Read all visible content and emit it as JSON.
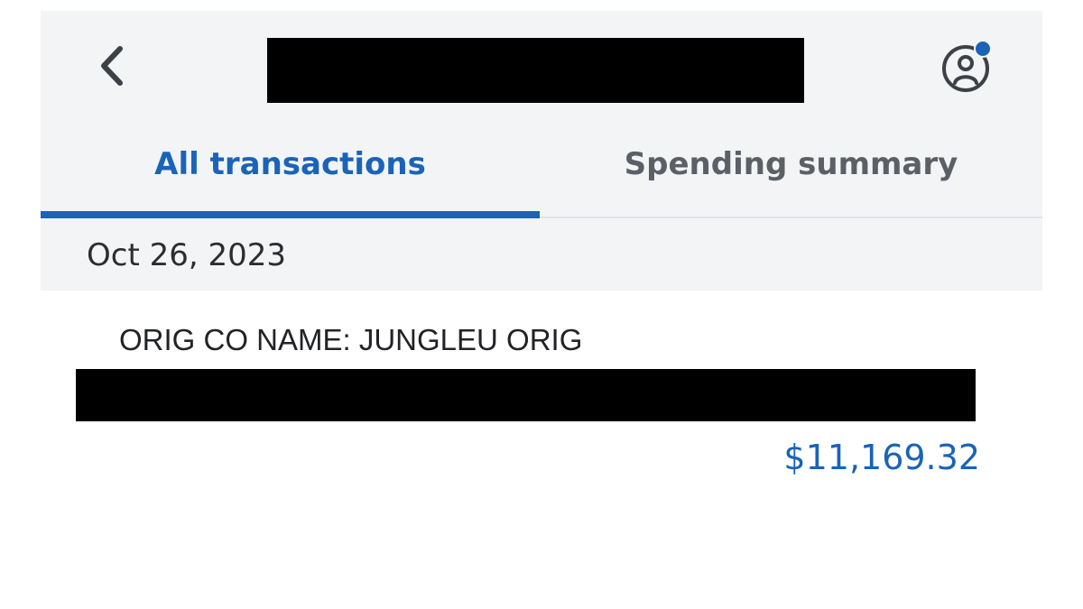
{
  "header": {
    "back_icon": "chevron-left-icon",
    "profile_icon": "user-circle-icon",
    "notification_color": "#1a63b8"
  },
  "tabs": [
    {
      "label": "All transactions",
      "active": true
    },
    {
      "label": "Spending summary",
      "active": false
    }
  ],
  "date_group": {
    "date": "Oct 26, 2023"
  },
  "transaction": {
    "name": "ORIG CO NAME: JUNGLEU ORIG",
    "amount": "$11,169.32"
  },
  "colors": {
    "accent": "#1a63b8",
    "panel_background": "#f3f4f6",
    "inactive_tab": "#5b5f66"
  }
}
